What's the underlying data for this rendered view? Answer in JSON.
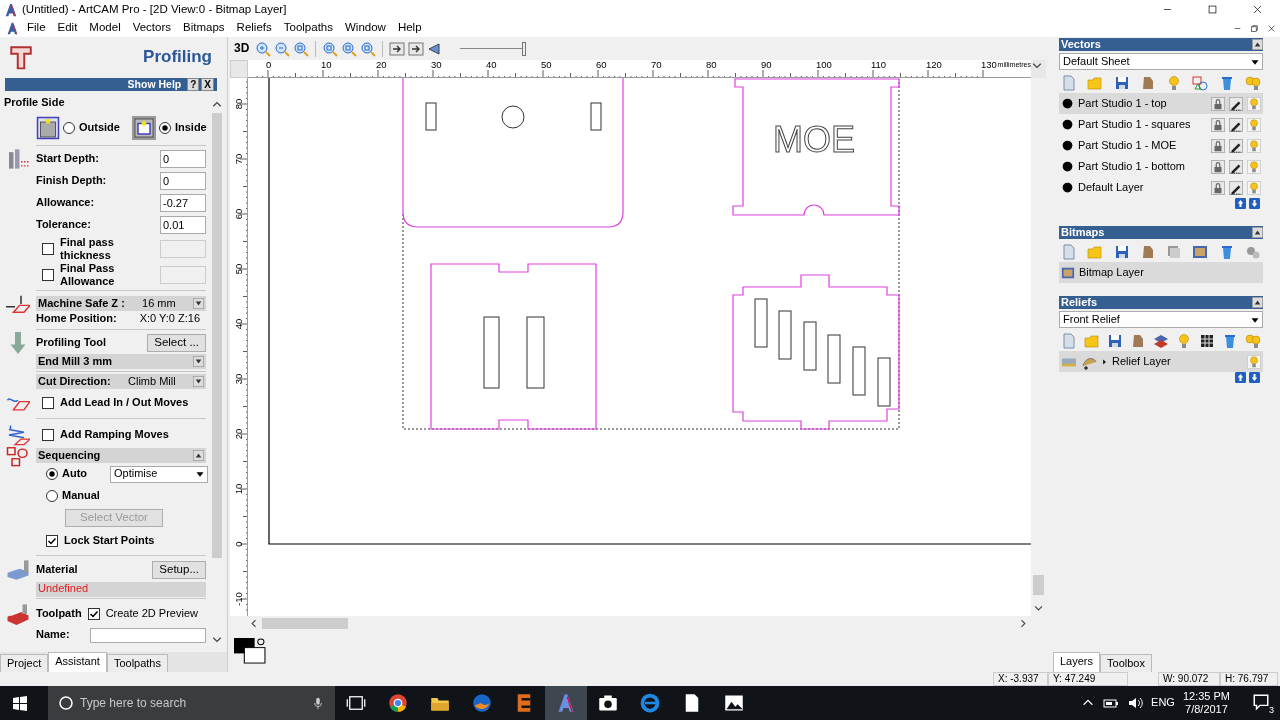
{
  "window": {
    "title": "(Untitled) - ArtCAM Pro - [2D View:0 - Bitmap Layer]"
  },
  "menu": [
    "File",
    "Edit",
    "Model",
    "Vectors",
    "Bitmaps",
    "Reliefs",
    "Toolpaths",
    "Window",
    "Help"
  ],
  "assistant": {
    "title": "Profiling",
    "help_label": "Show Help",
    "help_button": "?",
    "close_button": "X",
    "profile_side": {
      "label": "Profile Side",
      "options": [
        {
          "label": "Outside",
          "selected": false
        },
        {
          "label": "Inside",
          "selected": true
        }
      ]
    },
    "fields": [
      {
        "label": "Start Depth:",
        "value": "0"
      },
      {
        "label": "Finish Depth:",
        "value": "0"
      },
      {
        "label": "Allowance:",
        "value": "-0.27"
      },
      {
        "label": "Tolerance:",
        "value": "0.01"
      }
    ],
    "final_pass": [
      {
        "label": "Final pass thickness",
        "checked": false,
        "disabled": true
      },
      {
        "label": "Final Pass Allowance",
        "checked": false,
        "disabled": true
      }
    ],
    "safe_z": "**Machine Safe Z :** 16 mm",
    "home": {
      "label": "Home Position:",
      "value": "X:0 Y:0 Z:16"
    },
    "tool": {
      "label": "Profiling Tool",
      "button": "Select ...",
      "value": "End Mill 3 mm"
    },
    "cut_direction": "**Cut Direction:** Climb Mill",
    "options": [
      {
        "label": "Add Lead In / Out Moves",
        "checked": false
      },
      {
        "label": "Add Ramping Moves",
        "checked": false
      }
    ],
    "sequencing": {
      "title": "Sequencing",
      "modes": [
        {
          "label": "Auto",
          "selected": true
        },
        {
          "label": "Manual",
          "selected": false
        }
      ],
      "method": "Optimise",
      "select_vector": {
        "label": "Select Vector",
        "disabled": true
      },
      "lock_start": {
        "label": "Lock Start Points",
        "checked": true
      }
    },
    "material": {
      "label": "Material",
      "button": "Setup...",
      "value": "Undefined"
    },
    "toolpath": {
      "label": "Toolpath",
      "preview": {
        "label": "Create 2D Preview",
        "checked": true
      },
      "name_label": "Name:"
    }
  },
  "left_tabs": [
    {
      "label": "Project",
      "selected": false
    },
    {
      "label": "Assistant",
      "selected": true
    },
    {
      "label": "Toolpaths",
      "selected": false
    }
  ],
  "view_toolbar": {
    "mode": "3D",
    "slider": {
      "level": 1
    }
  },
  "ruler": {
    "x_labels": [
      "0",
      "10",
      "20",
      "30",
      "40",
      "50",
      "60",
      "70",
      "80",
      "90",
      "100",
      "110",
      "120",
      "130"
    ],
    "unit": "millimetres",
    "y_labels": [
      "80",
      "70",
      "60",
      "50",
      "40",
      "30",
      "20",
      "10",
      "0",
      "-10"
    ]
  },
  "drawing": {
    "engraved_text": "MOE"
  },
  "vectors": {
    "title": "Vectors",
    "sheet": "Default Sheet",
    "layers": [
      {
        "name": "Part Studio 1 - top",
        "selected": true
      },
      {
        "name": "Part Studio 1 - squares",
        "selected": false
      },
      {
        "name": "Part Studio 1 - MOE",
        "selected": false
      },
      {
        "name": "Part Studio 1 - bottom",
        "selected": false
      },
      {
        "name": "Default Layer",
        "selected": false
      }
    ]
  },
  "bitmaps": {
    "title": "Bitmaps",
    "layers": [
      {
        "name": "Bitmap Layer",
        "selected": true
      }
    ]
  },
  "reliefs": {
    "title": "Reliefs",
    "sheet": "Front Relief",
    "layers": [
      {
        "name": "Relief Layer",
        "selected": true
      }
    ]
  },
  "right_tabs": [
    {
      "label": "Layers",
      "selected": true
    },
    {
      "label": "Toolbox",
      "selected": false
    }
  ],
  "status_bar": [
    "X: -3.937",
    "Y: 47.249",
    "W: 90.072",
    "H: 76.797"
  ],
  "taskbar": {
    "search_placeholder": "Type here to search",
    "language": "ENG",
    "time": "12:35 PM",
    "date": "7/8/2017",
    "notifications": "3"
  }
}
